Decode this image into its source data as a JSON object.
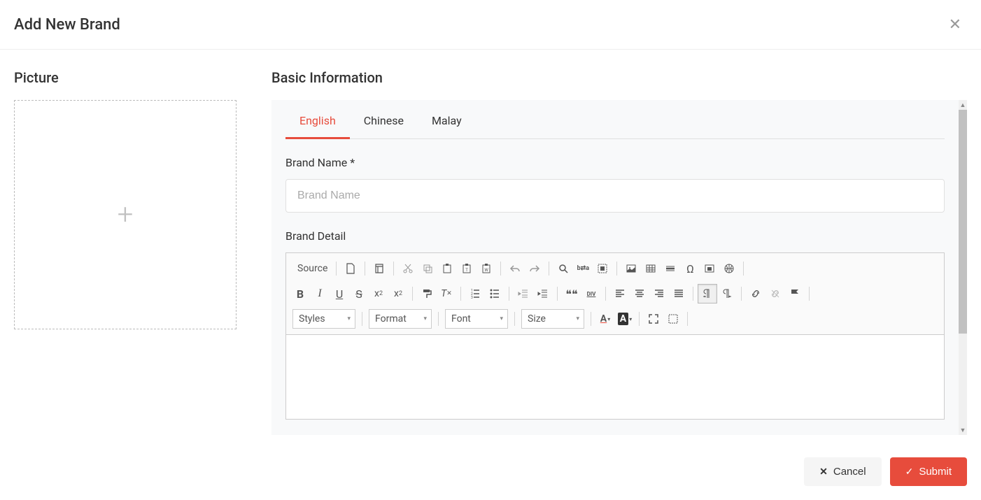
{
  "modal": {
    "title": "Add New Brand"
  },
  "picture": {
    "section_title": "Picture"
  },
  "basic": {
    "section_title": "Basic Information",
    "tabs": [
      "English",
      "Chinese",
      "Malay"
    ],
    "brand_name_label": "Brand Name *",
    "brand_name_placeholder": "Brand Name",
    "brand_detail_label": "Brand Detail"
  },
  "editor": {
    "source_label": "Source",
    "styles_label": "Styles",
    "format_label": "Format",
    "font_label": "Font",
    "size_label": "Size",
    "sym_omega": "Ω",
    "sym_a": "A",
    "sym_quote": "❝❝",
    "sym_div": "DIV",
    "sym_subx": "x",
    "sym_sub2": "2",
    "sym_supx": "x",
    "sym_sup2": "2",
    "sym_txtcolor": "A",
    "sym_bgcolor": "A",
    "sym_find": "b⇄a"
  },
  "footer": {
    "cancel_label": "Cancel",
    "submit_label": "Submit"
  }
}
